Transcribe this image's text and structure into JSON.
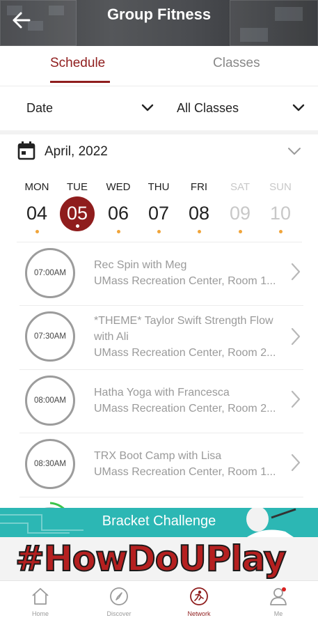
{
  "header": {
    "title": "Group Fitness",
    "back_icon": "arrow-left-icon"
  },
  "tabs": [
    {
      "label": "Schedule",
      "active": true
    },
    {
      "label": "Classes",
      "active": false
    }
  ],
  "filters": {
    "date_label": "Date",
    "classes_label": "All Classes"
  },
  "calendar": {
    "month_label": "April,  2022",
    "days": [
      {
        "dow": "MON",
        "date": "04",
        "has_events": true,
        "weekend": false,
        "selected": false
      },
      {
        "dow": "TUE",
        "date": "05",
        "has_events": true,
        "weekend": false,
        "selected": true
      },
      {
        "dow": "WED",
        "date": "06",
        "has_events": true,
        "weekend": false,
        "selected": false
      },
      {
        "dow": "THU",
        "date": "07",
        "has_events": true,
        "weekend": false,
        "selected": false
      },
      {
        "dow": "FRI",
        "date": "08",
        "has_events": true,
        "weekend": false,
        "selected": false
      },
      {
        "dow": "SAT",
        "date": "09",
        "has_events": true,
        "weekend": true,
        "selected": false
      },
      {
        "dow": "SUN",
        "date": "10",
        "has_events": true,
        "weekend": true,
        "selected": false
      }
    ]
  },
  "classes": [
    {
      "time": "07:00AM",
      "name": "Rec Spin with Meg",
      "location": "UMass Recreation Center, Room 1..."
    },
    {
      "time": "07:30AM",
      "name": "*THEME* Taylor Swift Strength Flow with Ali",
      "location": "UMass Recreation Center, Room 2..."
    },
    {
      "time": "08:00AM",
      "name": "Hatha Yoga with Francesca",
      "location": "UMass Recreation Center, Room 2..."
    },
    {
      "time": "08:30AM",
      "name": "TRX  Boot Camp with Lisa",
      "location": "UMass Recreation Center, Room 1..."
    }
  ],
  "banner": {
    "title": "Bracket Challenge",
    "hashtag": "#HowDoUPlay"
  },
  "bottom_nav": [
    {
      "label": "Home",
      "icon": "home-icon",
      "active": false
    },
    {
      "label": "Discover",
      "icon": "compass-icon",
      "active": false
    },
    {
      "label": "Network",
      "icon": "network-icon",
      "active": true
    },
    {
      "label": "Me",
      "icon": "user-icon",
      "active": false
    }
  ],
  "colors": {
    "accent": "#8f1d1d",
    "event_dot": "#f0a43a",
    "banner_teal": "#2cb7b4",
    "progress_green": "#3cc44a"
  }
}
